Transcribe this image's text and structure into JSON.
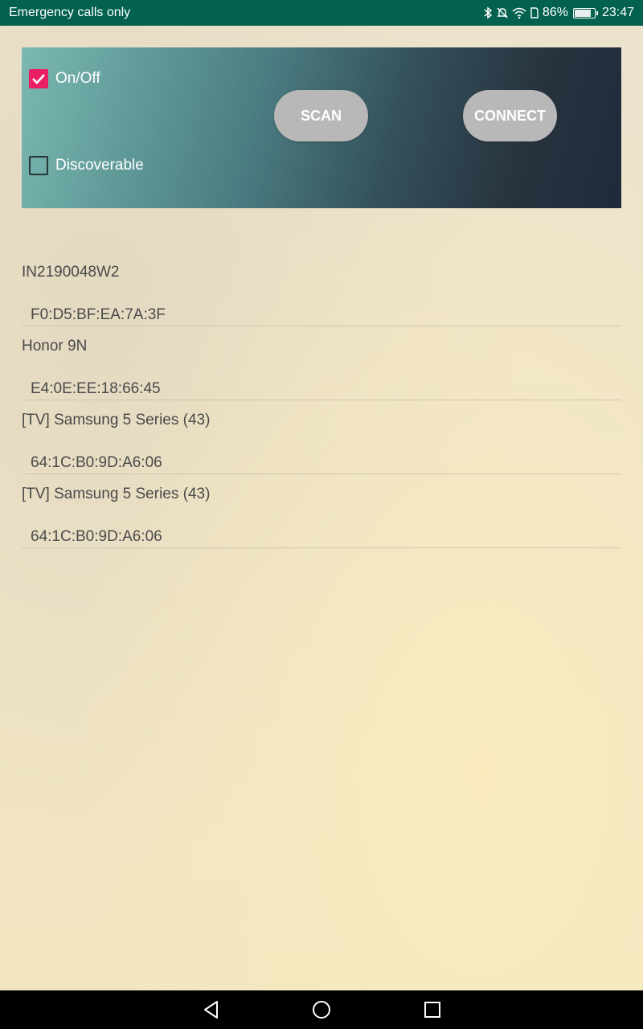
{
  "status_bar": {
    "carrier": "Emergency calls only",
    "battery_percent": "86%",
    "battery_level": 0.86,
    "time": "23:47",
    "icons": [
      "bluetooth-icon",
      "mute-icon",
      "wifi-icon",
      "sim-icon",
      "battery-icon"
    ]
  },
  "controls": {
    "onoff_label": "On/Off",
    "onoff_checked": true,
    "discoverable_label": "Discoverable",
    "discoverable_checked": false,
    "scan_label": "SCAN",
    "connect_label": "CONNECT"
  },
  "devices": [
    {
      "name": "IN2190048W2",
      "address": "F0:D5:BF:EA:7A:3F"
    },
    {
      "name": "Honor 9N",
      "address": "E4:0E:EE:18:66:45"
    },
    {
      "name": "[TV] Samsung 5 Series (43)",
      "address": "64:1C:B0:9D:A6:06"
    },
    {
      "name": "[TV] Samsung 5 Series (43)",
      "address": "64:1C:B0:9D:A6:06"
    }
  ],
  "navbar": {
    "icons": [
      "back-icon",
      "home-icon",
      "recents-icon"
    ]
  },
  "colors": {
    "status_bar": "#03614f",
    "checkbox_accent": "#e91e63",
    "button": "#b8b8b8"
  }
}
